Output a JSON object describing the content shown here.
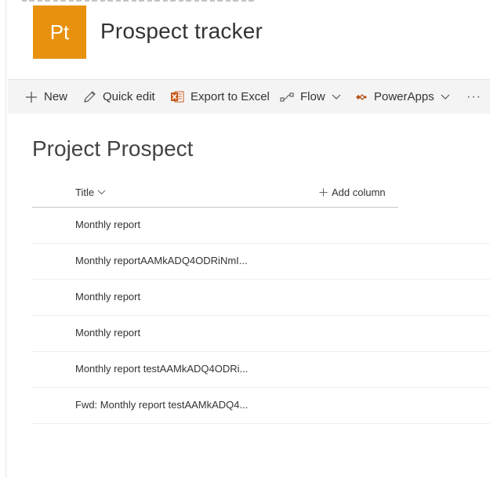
{
  "site": {
    "logo_text": "Pt",
    "title": "Prospect tracker",
    "accent_color": "#e8910e"
  },
  "command_bar": {
    "items": [
      {
        "label": "New",
        "icon": "plus-icon"
      },
      {
        "label": "Quick edit",
        "icon": "pencil-icon"
      },
      {
        "label": "Export to Excel",
        "icon": "excel-icon"
      },
      {
        "label": "Flow",
        "icon": "flow-icon",
        "has_dropdown": true
      },
      {
        "label": "PowerApps",
        "icon": "powerapps-icon",
        "has_dropdown": true
      }
    ],
    "more_label": "···"
  },
  "list": {
    "title": "Project Prospect",
    "columns": [
      {
        "label": "Title",
        "sortable": true
      }
    ],
    "add_column_label": "Add column",
    "rows": [
      {
        "title": "Monthly report"
      },
      {
        "title": "Monthly reportAAMkADQ4ODRiNmI..."
      },
      {
        "title": "Monthly report"
      },
      {
        "title": "Monthly report"
      },
      {
        "title": "Monthly report testAAMkADQ4ODRi..."
      },
      {
        "title": "Fwd: Monthly report testAAMkADQ4..."
      }
    ]
  }
}
